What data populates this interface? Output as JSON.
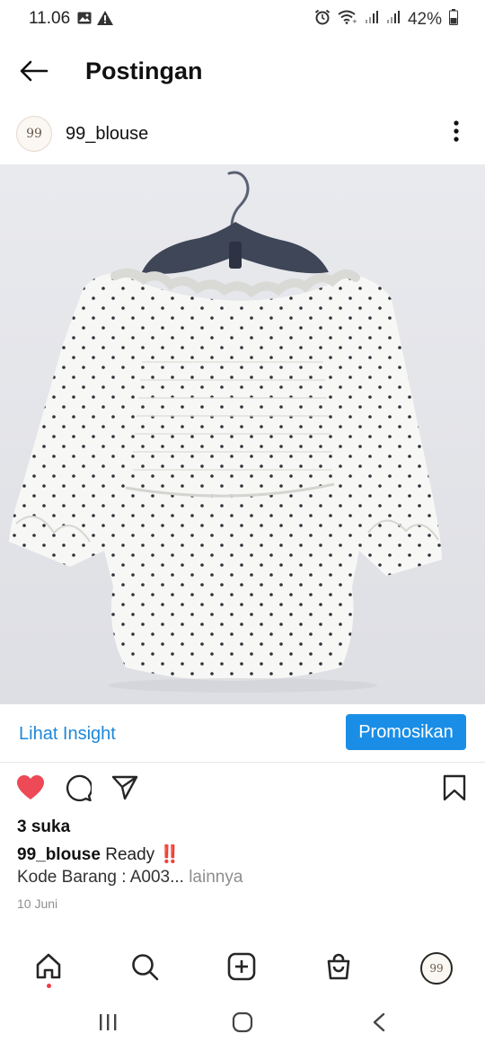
{
  "status": {
    "time": "11.06",
    "battery": "42%",
    "icons": [
      "image-icon",
      "warning-icon",
      "alarm-icon",
      "wifi-icon",
      "signal-icon",
      "signal-icon",
      "battery-icon"
    ]
  },
  "header": {
    "title": "Postingan",
    "back_icon": "back-arrow-icon"
  },
  "post": {
    "avatar_text": "99",
    "username": "99_blouse",
    "more_icon": "more-vertical-icon",
    "image_subject": "blouse-on-hanger-photo"
  },
  "insight": {
    "link_label": "Lihat Insight",
    "button_label": "Promosikan"
  },
  "actions": {
    "like_icon": "heart-icon",
    "comment_icon": "comment-icon",
    "share_icon": "send-icon",
    "save_icon": "bookmark-icon",
    "accent": "#ed4956"
  },
  "likes": "3 suka",
  "caption": {
    "username": "99_blouse",
    "text": "Ready",
    "emoji": "‼️",
    "line2": "Kode Barang : A003...",
    "more": " lainnya"
  },
  "date": "10 Juni",
  "nav": {
    "items": [
      "home-icon",
      "search-icon",
      "create-icon",
      "shop-icon",
      "profile-avatar"
    ],
    "avatar_text": "99"
  },
  "system_nav": [
    "recents-icon",
    "home-circle-icon",
    "back-chevron-icon"
  ],
  "colors": {
    "link_blue": "#1e88d8",
    "promo_blue": "#1a8ee6",
    "like_red": "#ed4956"
  }
}
